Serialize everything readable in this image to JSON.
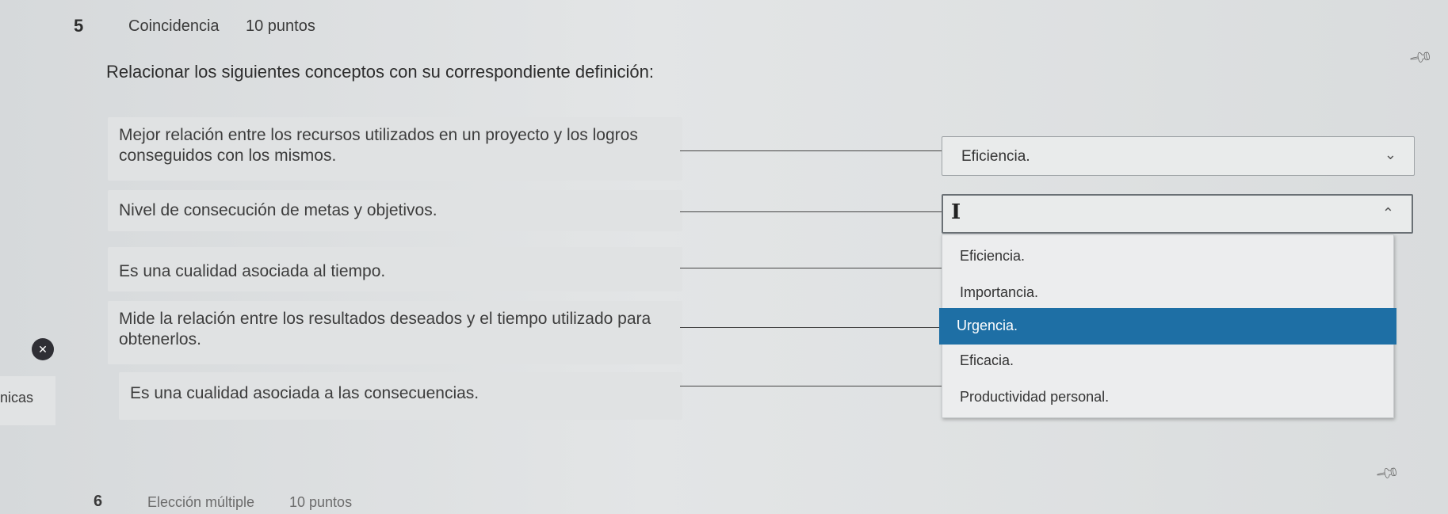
{
  "question": {
    "number": "5",
    "type": "Coincidencia",
    "points": "10 puntos",
    "instruction": "Relacionar los siguientes conceptos con su correspondiente definición:"
  },
  "prompts": [
    "Mejor relación entre los recursos utilizados en un proyecto y los logros conseguidos con los mismos.",
    "Nivel de consecución de metas y objetivos.",
    "Es una cualidad asociada al tiempo.",
    "Mide la relación entre los resultados deseados y el tiempo utilizado para obtenerlos.",
    "Es una cualidad asociada a las consecuencias."
  ],
  "answers": {
    "first_selected": "Eficiencia."
  },
  "dropdown_options": [
    "Eficiencia.",
    "Importancia.",
    "Urgencia.",
    "Eficacia.",
    "Productividad personal."
  ],
  "dropdown_highlighted": "Urgencia.",
  "left_fragment": "nicas",
  "next_question": {
    "number": "6",
    "type": "Elección múltiple",
    "points": "10 puntos"
  },
  "icons": [
    "pin-icon",
    "chevron-down-icon",
    "chevron-up-icon",
    "text-cursor-icon",
    "close-icon"
  ],
  "colors": {
    "highlight": "#1e6fa5",
    "background": "#e3e5e6",
    "error_icon": "#2f2f35"
  }
}
